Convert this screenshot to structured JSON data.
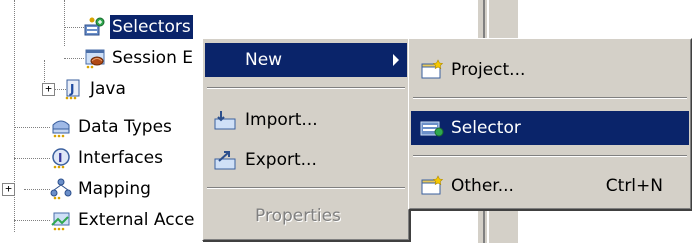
{
  "tree": {
    "items": [
      {
        "label": "Selectors",
        "icon": "selector-icon",
        "selected": true
      },
      {
        "label": "Session E",
        "icon": "session-icon"
      },
      {
        "label": "Java",
        "icon": "java-icon"
      },
      {
        "label": "Data Types",
        "icon": "data-types-icon"
      },
      {
        "label": "Interfaces",
        "icon": "interface-icon"
      },
      {
        "label": "Mapping",
        "icon": "mapping-icon"
      },
      {
        "label": "External Acce",
        "icon": "external-access-icon"
      }
    ],
    "expander_symbol": "+"
  },
  "context_menu": {
    "items": [
      {
        "label": "New",
        "has_submenu": true,
        "highlighted": true
      },
      {
        "label": "Import...",
        "icon": "import-icon"
      },
      {
        "label": "Export...",
        "icon": "export-icon"
      },
      {
        "label": "Properties",
        "disabled": true
      }
    ]
  },
  "submenu": {
    "items": [
      {
        "label": "Project...",
        "icon": "new-project-icon"
      },
      {
        "label": "Selector",
        "icon": "selector-icon",
        "highlighted": true
      },
      {
        "label": "Other...",
        "icon": "new-other-icon",
        "shortcut": "Ctrl+N"
      }
    ]
  },
  "colors": {
    "selection": "#0a246a",
    "menu_bg": "#d4d0c8",
    "disabled_text": "#808080"
  }
}
